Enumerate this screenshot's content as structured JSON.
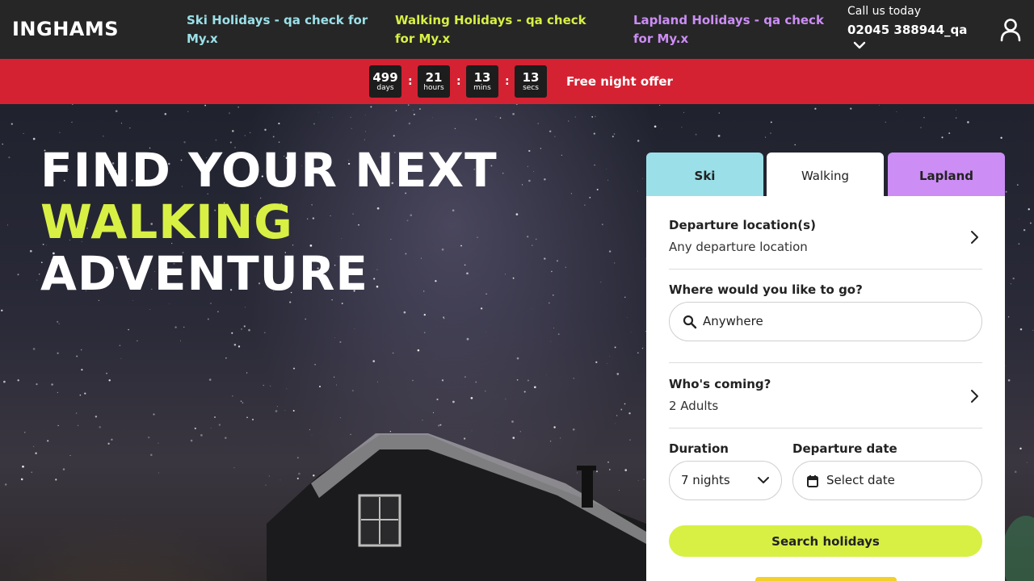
{
  "header": {
    "logo": "INGHAMS",
    "nav": [
      {
        "label": "Ski Holidays - qa check for My.x",
        "color": "#9be0e8"
      },
      {
        "label": "Walking Holidays - qa check for My.x",
        "color": "#d8f044"
      },
      {
        "label": "Lapland Holidays - qa check for My.x",
        "color": "#cc8df5"
      }
    ],
    "call_label": "Call us today",
    "phone": "02045 388944_qa",
    "icons": {
      "phone_dropdown": "chevron-down-icon",
      "account": "user-icon"
    }
  },
  "promo": {
    "countdown": [
      {
        "value": "499",
        "unit": "days"
      },
      {
        "value": "21",
        "unit": "hours"
      },
      {
        "value": "13",
        "unit": "mins"
      },
      {
        "value": "13",
        "unit": "secs"
      }
    ],
    "separator": ":",
    "text": "Free night offer"
  },
  "hero": {
    "line1": "FIND YOUR NEXT",
    "line2": "WALKING",
    "line3": "ADVENTURE"
  },
  "search": {
    "tabs": [
      {
        "label": "Ski",
        "active": false
      },
      {
        "label": "Walking",
        "active": true
      },
      {
        "label": "Lapland",
        "active": false
      }
    ],
    "departure": {
      "title": "Departure location(s)",
      "value": "Any departure location"
    },
    "destination": {
      "title": "Where would you like to go?",
      "value": "Anywhere"
    },
    "guests": {
      "title": "Who's coming?",
      "value": "2 Adults"
    },
    "duration": {
      "title": "Duration",
      "value": "7 nights"
    },
    "date": {
      "title": "Departure date",
      "value": "Select date"
    },
    "button": "Search holidays"
  },
  "colors": {
    "header_bg": "#262626",
    "promo_bg": "#d42232",
    "accent_lime": "#d8f044",
    "ski_cyan": "#9be0e8",
    "lapland_purple": "#cc8df5"
  }
}
